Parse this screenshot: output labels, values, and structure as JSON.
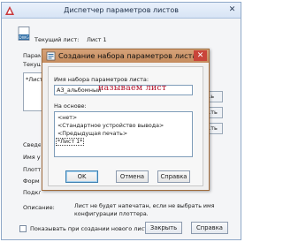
{
  "main_dialog": {
    "title": "Диспетчер параметров листов",
    "current_layout_label": "Текущий лист:",
    "current_layout_value": "Лист 1",
    "file_icon_label": "DWG",
    "partial_labels": [
      "Параме",
      "Текущ",
      "Сведе",
      "Имя у",
      "Плотт",
      "Форм",
      "Подкл"
    ],
    "list_item": "*Лист",
    "side_buttons": [
      "...ь",
      "...ть",
      "...ть"
    ],
    "description_label": "Описание:",
    "description_text": "Лист не будет напечатан, если не выбрать имя конфигурации плоттера.",
    "show_on_create_label": "Показывать при создании нового листа",
    "close_button": "Закрыть",
    "help_button": "Справка"
  },
  "new_setup_dialog": {
    "title": "Создание набора параметров листа",
    "name_label": "Имя набора параметров листа:",
    "name_value": "А3_альбомный",
    "annotation": "называем лист",
    "based_on_label": "На основе:",
    "based_on_items": [
      "<нет>",
      "<Стандартное устройство вывода>",
      "<Предыдущая печать>",
      "*Лист 1*"
    ],
    "ok_button": "OK",
    "cancel_button": "Отмена",
    "help_button": "Справка"
  },
  "colors": {
    "child_title_bar": "#c58c5e",
    "child_close": "#c9453a",
    "annotation": "#b3122b",
    "main_title_bar": "#d7e4f5"
  },
  "icons": [
    "autocad-app-icon",
    "close-icon",
    "dwg-file-icon",
    "page-setup-icon"
  ]
}
